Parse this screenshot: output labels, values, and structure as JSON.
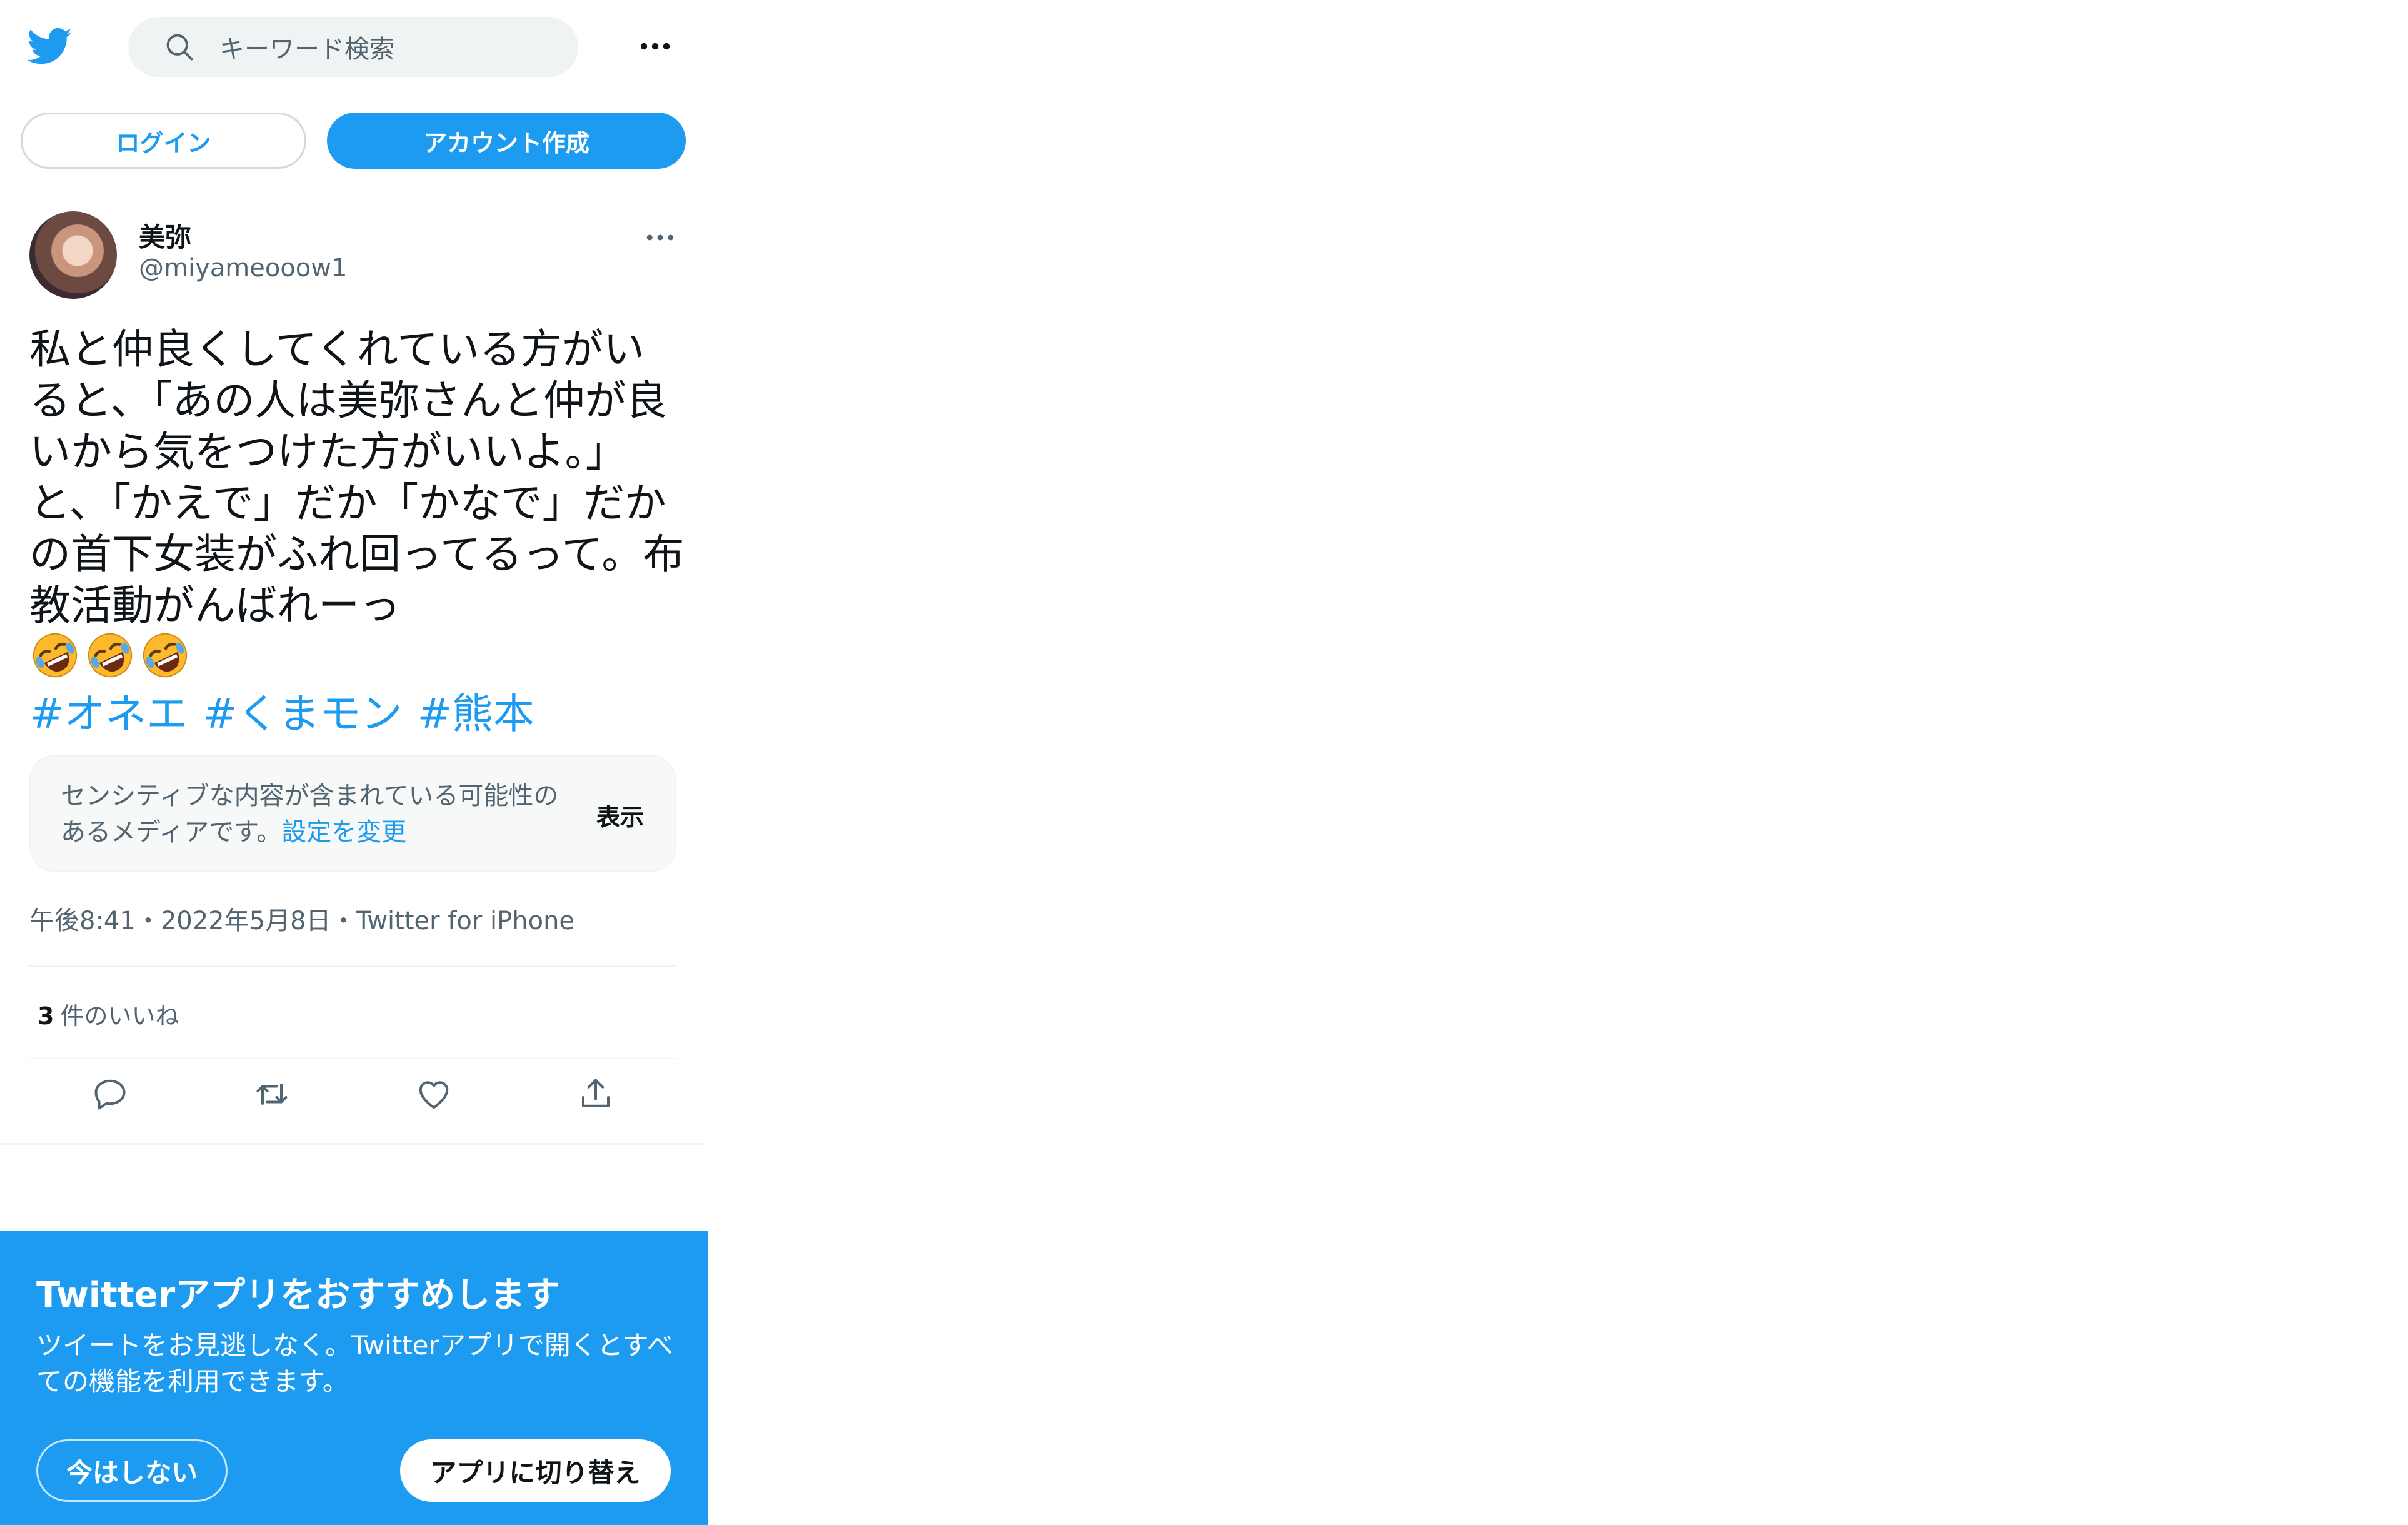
{
  "header": {
    "logo_icon": "twitter-bird-icon",
    "search_placeholder": "キーワード検索",
    "more_icon": "more-horizontal-icon",
    "accent_color": "#1d9bf0"
  },
  "auth": {
    "login_label": "ログイン",
    "signup_label": "アカウント作成"
  },
  "tweet": {
    "display_name": "美弥",
    "handle": "@miyameooow1",
    "text": "私と仲良くしてくれている方がいると、「あの人は美弥さんと仲が良いから気をつけた方がいいよ。」と、「かえで」だか「かなで」だかの首下女装がふれ回ってるって。布教活動がんばれーっ",
    "emojis": [
      "rolling-on-floor-laughing",
      "rolling-on-floor-laughing",
      "rolling-on-floor-laughing"
    ],
    "hashtags": [
      "#オネエ",
      "#くまモン",
      "#熊本"
    ],
    "sensitive": {
      "message": "センシティブな内容が含まれている可能性のあるメディアです。",
      "settings_link": "設定を変更",
      "show_label": "表示"
    },
    "meta": "午後8:41・2022年5月8日・Twitter for iPhone",
    "likes_count": "3",
    "likes_label": "件のいいね",
    "actions": [
      "reply-icon",
      "retweet-icon",
      "like-icon",
      "share-icon"
    ]
  },
  "promo": {
    "title": "Twitterアプリをおすすめします",
    "description": "ツイートをお見逃しなく。Twitterアプリで開くとすべての機能を利用できます。",
    "not_now_label": "今はしない",
    "switch_label": "アプリに切り替え"
  }
}
